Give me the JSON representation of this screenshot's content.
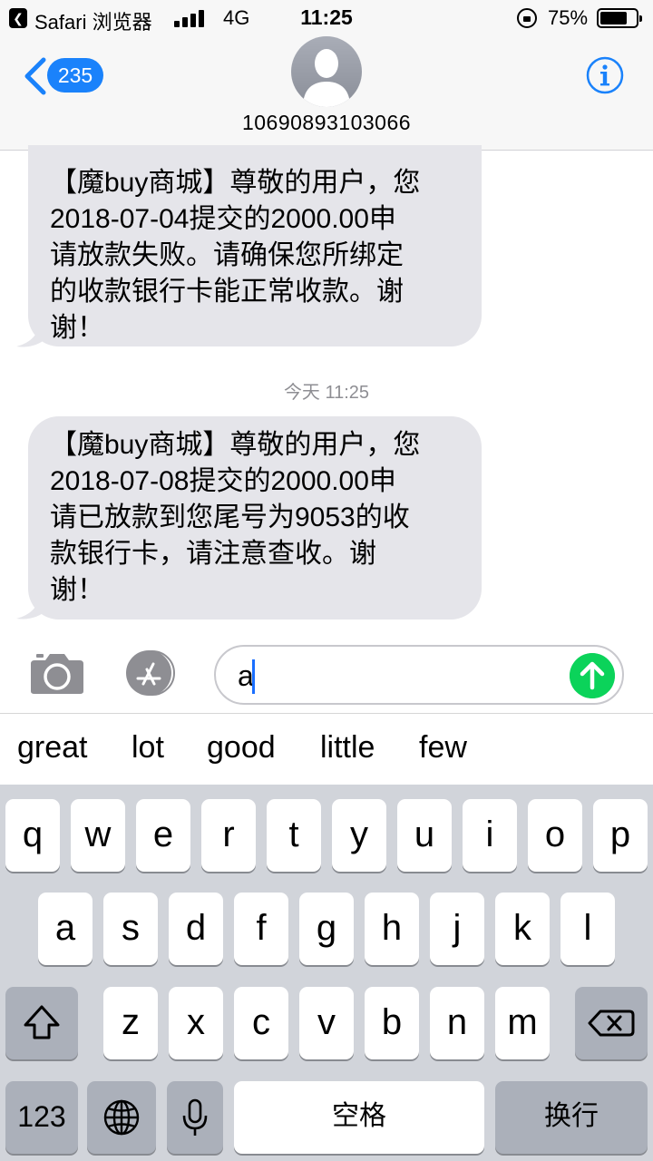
{
  "status_bar": {
    "back_app_label": "Safari 浏览器",
    "network": "4G",
    "time": "11:25",
    "battery_percent": "75%",
    "battery_level": 0.75
  },
  "header": {
    "back_count": "235",
    "contact_number": "10690893103066",
    "info_icon": "info-icon"
  },
  "messages": [
    {
      "text": "【魔buy商城】尊敬的用户，您\n2018-07-04提交的2000.00申\n请放款失败。请确保您所绑定\n的收款银行卡能正常收款。谢\n谢！"
    },
    {
      "text": "【魔buy商城】尊敬的用户，您\n2018-07-08提交的2000.00申\n请已放款到您尾号为9053的收\n款银行卡，请注意查收。谢\n谢！"
    }
  ],
  "timestamp": "今天 11:25",
  "composer": {
    "typed_text": "a"
  },
  "predictions": [
    "great",
    "lot",
    "good",
    "little",
    "few"
  ],
  "keyboard": {
    "row1": [
      "q",
      "w",
      "e",
      "r",
      "t",
      "y",
      "u",
      "i",
      "o",
      "p"
    ],
    "row2": [
      "a",
      "s",
      "d",
      "f",
      "g",
      "h",
      "j",
      "k",
      "l"
    ],
    "row3": [
      "z",
      "x",
      "c",
      "v",
      "b",
      "n",
      "m"
    ],
    "numbers_key": "123",
    "space_key": "空格",
    "return_key": "换行"
  },
  "colors": {
    "accent_blue": "#1a82fb",
    "bubble_gray": "#e5e5ea",
    "send_green": "#0bd35a",
    "keyboard_bg": "#d1d4da"
  }
}
